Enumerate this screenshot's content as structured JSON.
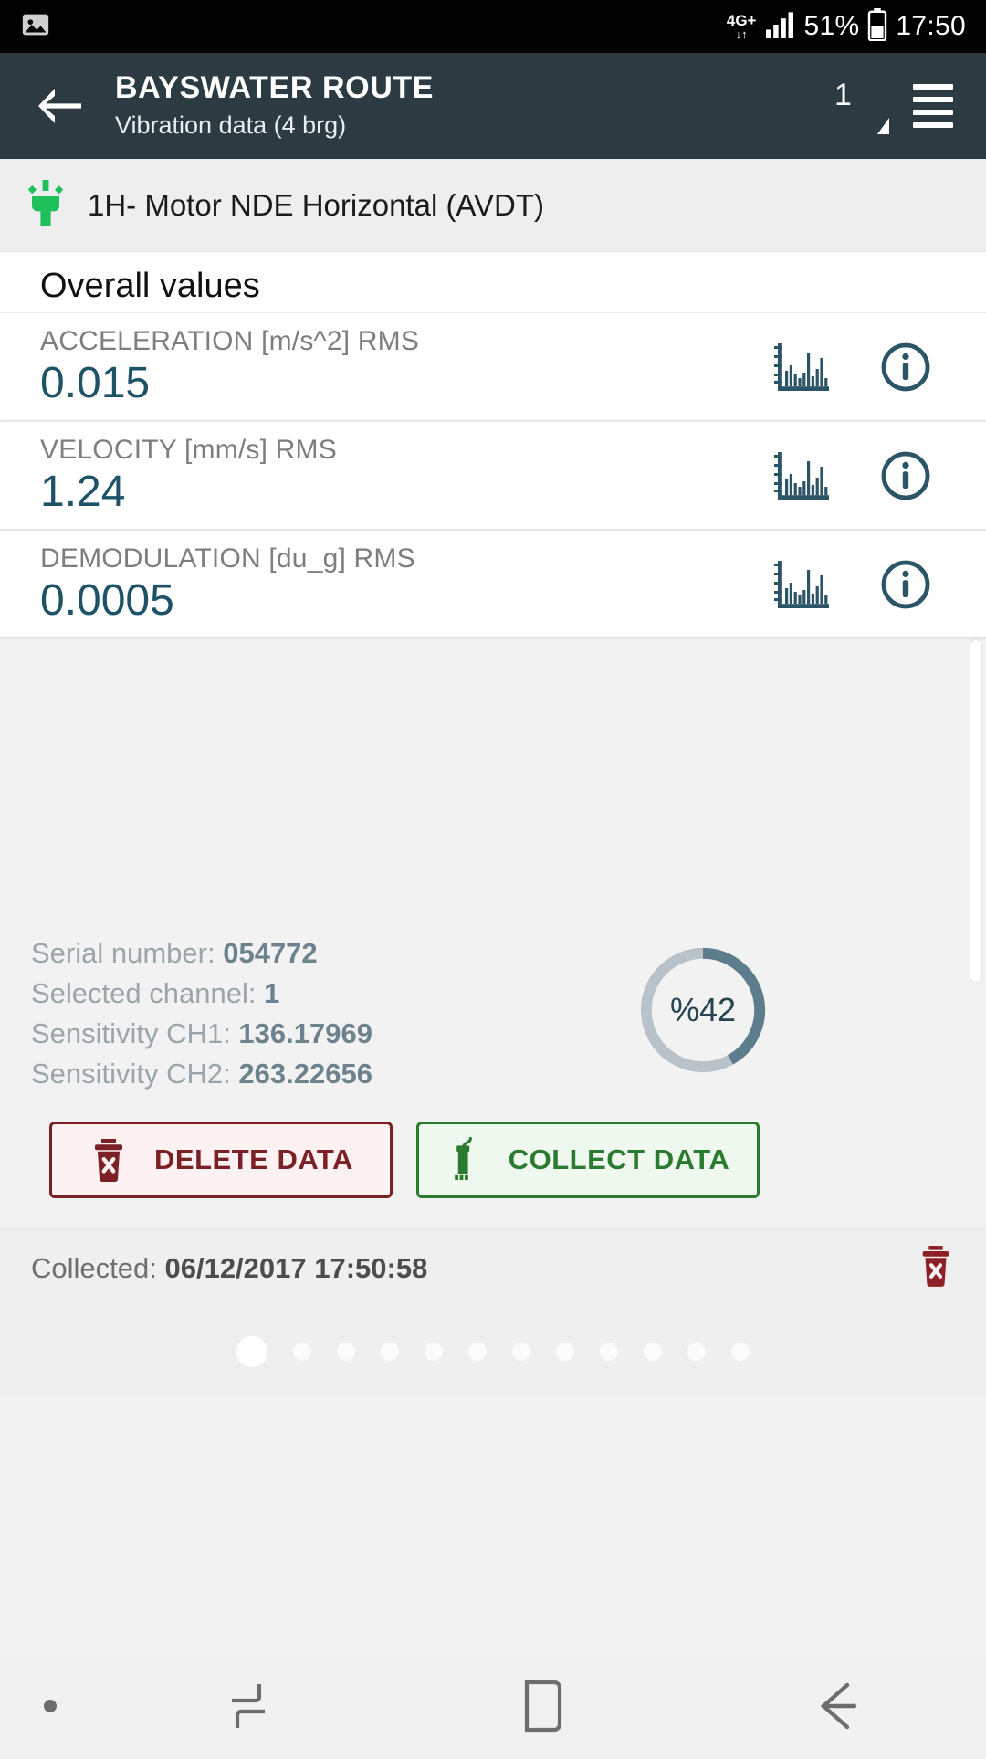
{
  "status_bar": {
    "left_icon": "image-icon",
    "network_type": "4G+",
    "network_sub": "↓↑",
    "signal_icon": "signal-bars-icon",
    "battery_percent": "51%",
    "battery_icon": "battery-icon",
    "time": "17:50"
  },
  "app_bar": {
    "back_icon": "arrow-left-icon",
    "title": "BAYSWATER ROUTE",
    "subtitle": "Vibration data (4 brg)",
    "channel_number": "1",
    "channel_triangle_icon": "triangle-indicator-icon",
    "menu_icon": "list-menu-icon",
    "background_color": "#2c3a42"
  },
  "point_row": {
    "sensor_icon": "vibration-sensor-icon",
    "sensor_icon_color": "#1fbf5c",
    "label": "1H- Motor NDE Horizontal (AVDT)"
  },
  "overall_values": {
    "heading": "Overall values",
    "accent_color": "#1e5266",
    "cards": [
      {
        "label": "ACCELERATION [m/s^2] RMS",
        "value": "0.015",
        "spectrum_icon": "spectrum-chart-icon",
        "info_icon": "info-circle-icon"
      },
      {
        "label": "VELOCITY [mm/s] RMS",
        "value": "1.24",
        "spectrum_icon": "spectrum-chart-icon",
        "info_icon": "info-circle-icon"
      },
      {
        "label": "DEMODULATION [du_g] RMS",
        "value": "0.0005",
        "spectrum_icon": "spectrum-chart-icon",
        "info_icon": "info-circle-icon"
      }
    ]
  },
  "device_info": [
    {
      "label": "Serial number:",
      "value": "054772"
    },
    {
      "label": "Selected channel:",
      "value": "1"
    },
    {
      "label": "Sensitivity CH1:",
      "value": "136.17969"
    },
    {
      "label": "Sensitivity CH2:",
      "value": "263.22656"
    }
  ],
  "battery_gauge": {
    "text": "%42",
    "percent": 42,
    "arc_color": "#5e7d8c",
    "track_color": "#b9c2c8"
  },
  "actions": {
    "delete": {
      "label": "DELETE DATA",
      "icon": "trash-delete-icon",
      "color": "#7b2025",
      "background": "#fdf1f1"
    },
    "collect": {
      "label": "COLLECT DATA",
      "icon": "accelerometer-sensor-icon",
      "color": "#2a7a2f",
      "background": "#eef8ee"
    }
  },
  "collected_bar": {
    "label": "Collected:",
    "timestamp": "06/12/2017 17:50:58",
    "delete_icon": "trash-delete-icon"
  },
  "page_dots": {
    "count": 12,
    "active_index": 0
  },
  "nav_bar": {
    "dot_icon": "dot-icon",
    "recents_icon": "recents-icon",
    "home_icon": "home-icon",
    "back_icon": "back-arrow-icon"
  }
}
